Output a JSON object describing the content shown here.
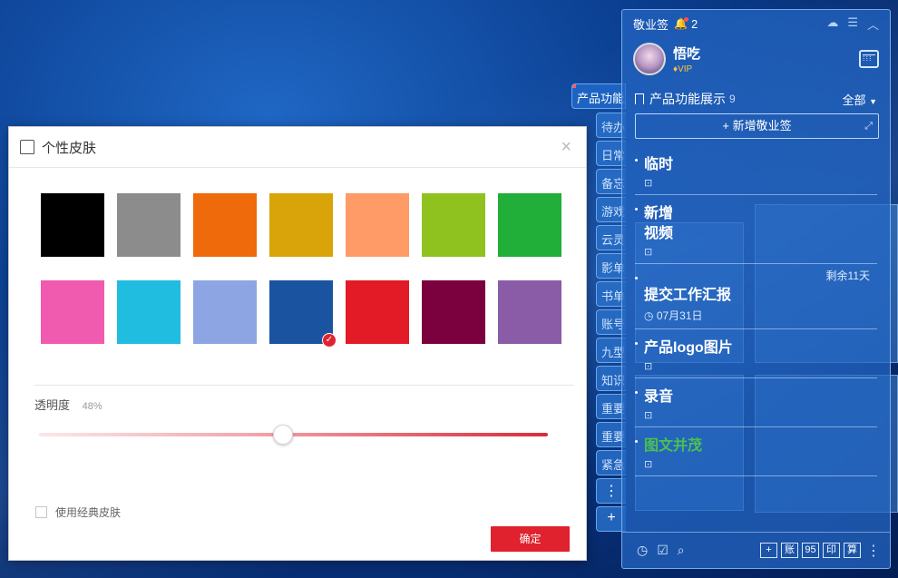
{
  "colors": {
    "accent": "#e0212e",
    "panel": "#2466c4",
    "swatches": [
      "#000000",
      "#8c8c8c",
      "#ee6a0a",
      "#d9a40a",
      "#ff9b66",
      "#8fc21f",
      "#21ae39",
      "#f05aaf",
      "#21bde0",
      "#8da5e2",
      "#1a54a0",
      "#e31b26",
      "#7a003e",
      "#8a5ca8"
    ],
    "selected_index": 10
  },
  "dialog": {
    "title": "个性皮肤",
    "close_icon": "×",
    "opacity_label": "透明度",
    "opacity_value": "48%",
    "opacity_level": 0.48,
    "classic_label": "使用经典皮肤",
    "ok_label": "确定"
  },
  "desktop_tabs": {
    "active": "产品功能展示",
    "items": [
      "待办",
      "日常",
      "备忘",
      "游戏",
      "云灵",
      "影单",
      "书单",
      "账号",
      "九型",
      "知识",
      "重要",
      "重要",
      "紧急"
    ],
    "more": "⋮",
    "add": "+"
  },
  "panel": {
    "app_name": "敬业签",
    "notif_count": "2",
    "user_name": "悟吃",
    "vip_label": "VIP",
    "section_name": "产品功能展示",
    "section_count": "9",
    "filter_label": "全部",
    "new_note_label": "+ 新增敬业签",
    "notes": [
      {
        "title": "临时",
        "date": "",
        "remaining": ""
      },
      {
        "title": "新增\n视频",
        "date": "",
        "remaining": ""
      },
      {
        "title": "提交工作汇报",
        "date": "07月31日",
        "remaining": "剩余11天"
      },
      {
        "title": "产品logo图片",
        "date": "",
        "remaining": ""
      },
      {
        "title": "录音",
        "date": "",
        "remaining": ""
      },
      {
        "title": "图文并茂",
        "date": "",
        "remaining": "",
        "color": "#4cc04f"
      }
    ],
    "footer_keys": [
      "+",
      "账",
      "95",
      "印",
      "算"
    ]
  }
}
